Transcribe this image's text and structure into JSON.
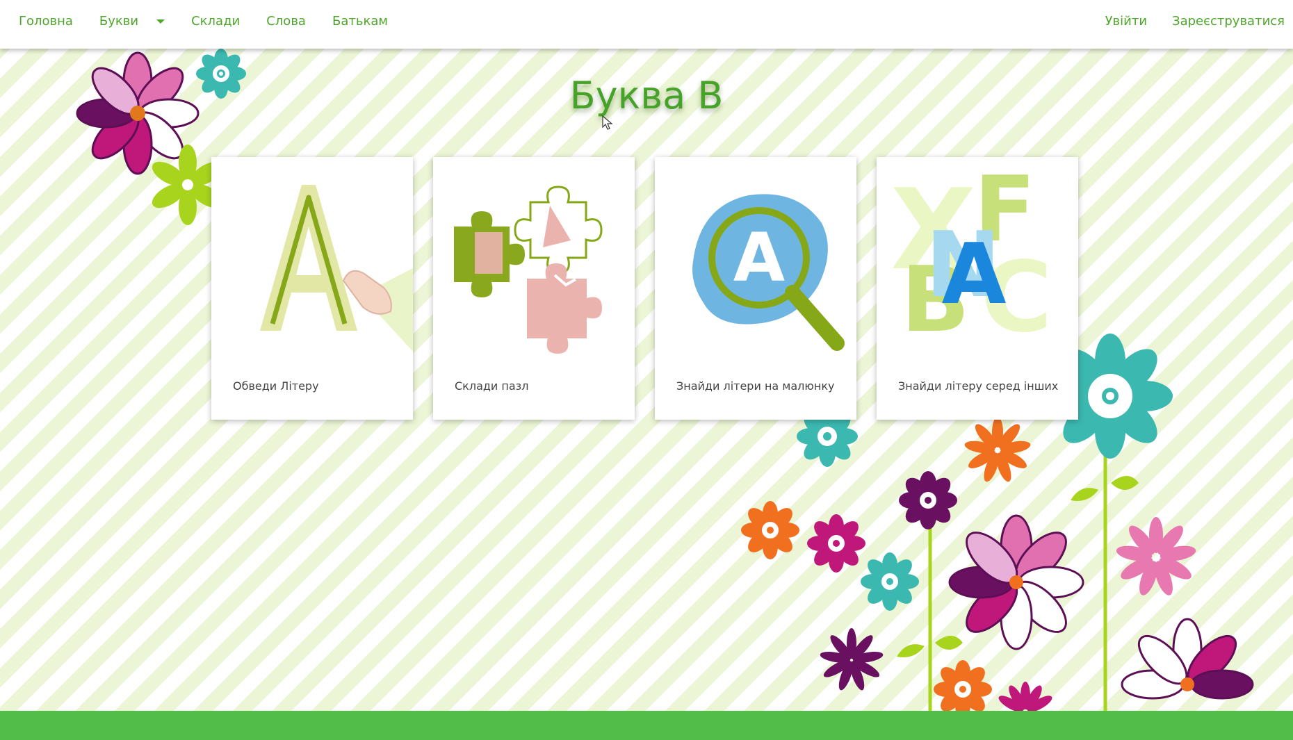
{
  "nav": {
    "left_items": [
      {
        "label": "Головна"
      },
      {
        "label": "Букви"
      },
      {
        "label": "Склади"
      },
      {
        "label": "Слова"
      },
      {
        "label": "Батькам"
      }
    ],
    "right_items": [
      {
        "label": "Увійти"
      },
      {
        "label": "Зареєструватися"
      }
    ]
  },
  "page_title": "Буква В",
  "cards": [
    {
      "label": "Обведи Літеру",
      "icon": "trace-letter-icon",
      "glyph": "A"
    },
    {
      "label": "Склади пазл",
      "icon": "puzzle-icon"
    },
    {
      "label": "Знайди літери на малюнку",
      "icon": "magnifier-letter-icon",
      "glyph": "A"
    },
    {
      "label": "Знайди літеру серед інших",
      "icon": "letters-mix-icon",
      "glyph": "A"
    }
  ],
  "colors": {
    "accent": "#4fa62c",
    "footer": "#53bd4a",
    "stripe": "#ecf6d6"
  }
}
